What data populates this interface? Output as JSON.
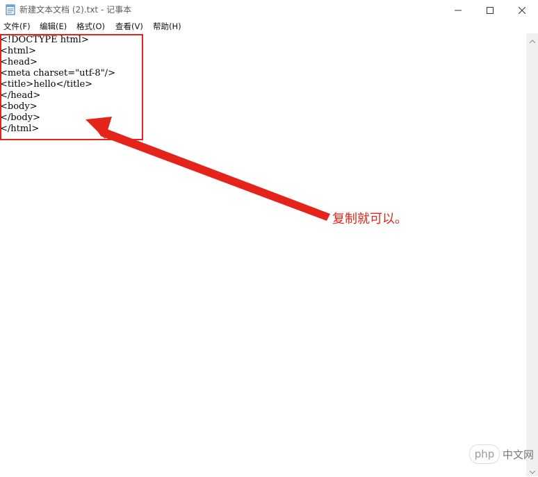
{
  "window": {
    "title": "新建文本文档 (2).txt - 记事本",
    "app_icon": "notepad-icon",
    "controls": [
      "minimize-icon",
      "maximize-icon",
      "close-icon"
    ]
  },
  "menu": {
    "items": [
      "文件(F)",
      "编辑(E)",
      "格式(O)",
      "查看(V)",
      "帮助(H)"
    ]
  },
  "editor": {
    "lines": [
      "<!DOCTYPE html>",
      "<html>",
      "<head>",
      "<meta charset=\"utf-8\"/>",
      "<title>hello</title>",
      "</head>",
      "<body>",
      "</body>",
      "</html>"
    ]
  },
  "annotation": {
    "text": "复制就可以。",
    "color": "#e4231b"
  },
  "watermark": {
    "logo": "php",
    "text": "中文网"
  }
}
